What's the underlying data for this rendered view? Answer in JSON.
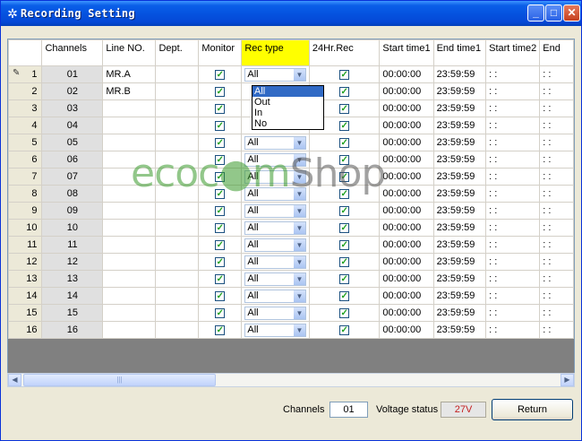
{
  "window": {
    "title": "Recording Setting",
    "icon": "gear-icon",
    "min": "_",
    "max": "□",
    "close": "✕"
  },
  "columns": [
    "",
    "Channels",
    "Line NO.",
    "Dept.",
    "Monitor",
    "Rec type",
    "24Hr.Rec",
    "Start time1",
    "End time1",
    "Start time2",
    "End"
  ],
  "rows": [
    {
      "num": "1",
      "channel": "01",
      "line": "MR.A",
      "dept": "",
      "monitor": true,
      "rec_type": "All",
      "hr24": true,
      "start1": "00:00:00",
      "end1": "23:59:59",
      "start2": ": :",
      "end2": ": :"
    },
    {
      "num": "2",
      "channel": "02",
      "line": "MR.B",
      "dept": "",
      "monitor": true,
      "rec_type": "",
      "hr24": true,
      "start1": "00:00:00",
      "end1": "23:59:59",
      "start2": ": :",
      "end2": ": :"
    },
    {
      "num": "3",
      "channel": "03",
      "line": "",
      "dept": "",
      "monitor": true,
      "rec_type": "",
      "hr24": true,
      "start1": "00:00:00",
      "end1": "23:59:59",
      "start2": ": :",
      "end2": ": :"
    },
    {
      "num": "4",
      "channel": "04",
      "line": "",
      "dept": "",
      "monitor": true,
      "rec_type": "",
      "hr24": true,
      "start1": "00:00:00",
      "end1": "23:59:59",
      "start2": ": :",
      "end2": ": :"
    },
    {
      "num": "5",
      "channel": "05",
      "line": "",
      "dept": "",
      "monitor": true,
      "rec_type": "All",
      "hr24": true,
      "start1": "00:00:00",
      "end1": "23:59:59",
      "start2": ": :",
      "end2": ": :"
    },
    {
      "num": "6",
      "channel": "06",
      "line": "",
      "dept": "",
      "monitor": true,
      "rec_type": "All",
      "hr24": true,
      "start1": "00:00:00",
      "end1": "23:59:59",
      "start2": ": :",
      "end2": ": :"
    },
    {
      "num": "7",
      "channel": "07",
      "line": "",
      "dept": "",
      "monitor": true,
      "rec_type": "All",
      "hr24": true,
      "start1": "00:00:00",
      "end1": "23:59:59",
      "start2": ": :",
      "end2": ": :"
    },
    {
      "num": "8",
      "channel": "08",
      "line": "",
      "dept": "",
      "monitor": true,
      "rec_type": "All",
      "hr24": true,
      "start1": "00:00:00",
      "end1": "23:59:59",
      "start2": ": :",
      "end2": ": :"
    },
    {
      "num": "9",
      "channel": "09",
      "line": "",
      "dept": "",
      "monitor": true,
      "rec_type": "All",
      "hr24": true,
      "start1": "00:00:00",
      "end1": "23:59:59",
      "start2": ": :",
      "end2": ": :"
    },
    {
      "num": "10",
      "channel": "10",
      "line": "",
      "dept": "",
      "monitor": true,
      "rec_type": "All",
      "hr24": true,
      "start1": "00:00:00",
      "end1": "23:59:59",
      "start2": ": :",
      "end2": ": :"
    },
    {
      "num": "11",
      "channel": "11",
      "line": "",
      "dept": "",
      "monitor": true,
      "rec_type": "All",
      "hr24": true,
      "start1": "00:00:00",
      "end1": "23:59:59",
      "start2": ": :",
      "end2": ": :"
    },
    {
      "num": "12",
      "channel": "12",
      "line": "",
      "dept": "",
      "monitor": true,
      "rec_type": "All",
      "hr24": true,
      "start1": "00:00:00",
      "end1": "23:59:59",
      "start2": ": :",
      "end2": ": :"
    },
    {
      "num": "13",
      "channel": "13",
      "line": "",
      "dept": "",
      "monitor": true,
      "rec_type": "All",
      "hr24": true,
      "start1": "00:00:00",
      "end1": "23:59:59",
      "start2": ": :",
      "end2": ": :"
    },
    {
      "num": "14",
      "channel": "14",
      "line": "",
      "dept": "",
      "monitor": true,
      "rec_type": "All",
      "hr24": true,
      "start1": "00:00:00",
      "end1": "23:59:59",
      "start2": ": :",
      "end2": ": :"
    },
    {
      "num": "15",
      "channel": "15",
      "line": "",
      "dept": "",
      "monitor": true,
      "rec_type": "All",
      "hr24": true,
      "start1": "00:00:00",
      "end1": "23:59:59",
      "start2": ": :",
      "end2": ": :"
    },
    {
      "num": "16",
      "channel": "16",
      "line": "",
      "dept": "",
      "monitor": true,
      "rec_type": "All",
      "hr24": true,
      "start1": "00:00:00",
      "end1": "23:59:59",
      "start2": ": :",
      "end2": ": :"
    }
  ],
  "dropdown": {
    "options": [
      "All",
      "Out",
      "In",
      "No"
    ],
    "selected": "All"
  },
  "watermark": {
    "part1": "ecoc",
    "part2": "m",
    "part3": "Shop"
  },
  "footer": {
    "channels_label": "Channels",
    "channels_value": "01",
    "voltage_label": "Voltage status",
    "voltage_value": "27V",
    "return_label": "Return"
  },
  "colors": {
    "title_bar": "#0553e0",
    "rec_type_header": "#ffff00",
    "voltage_text": "#c42020",
    "selected_option": "#316ac5"
  }
}
